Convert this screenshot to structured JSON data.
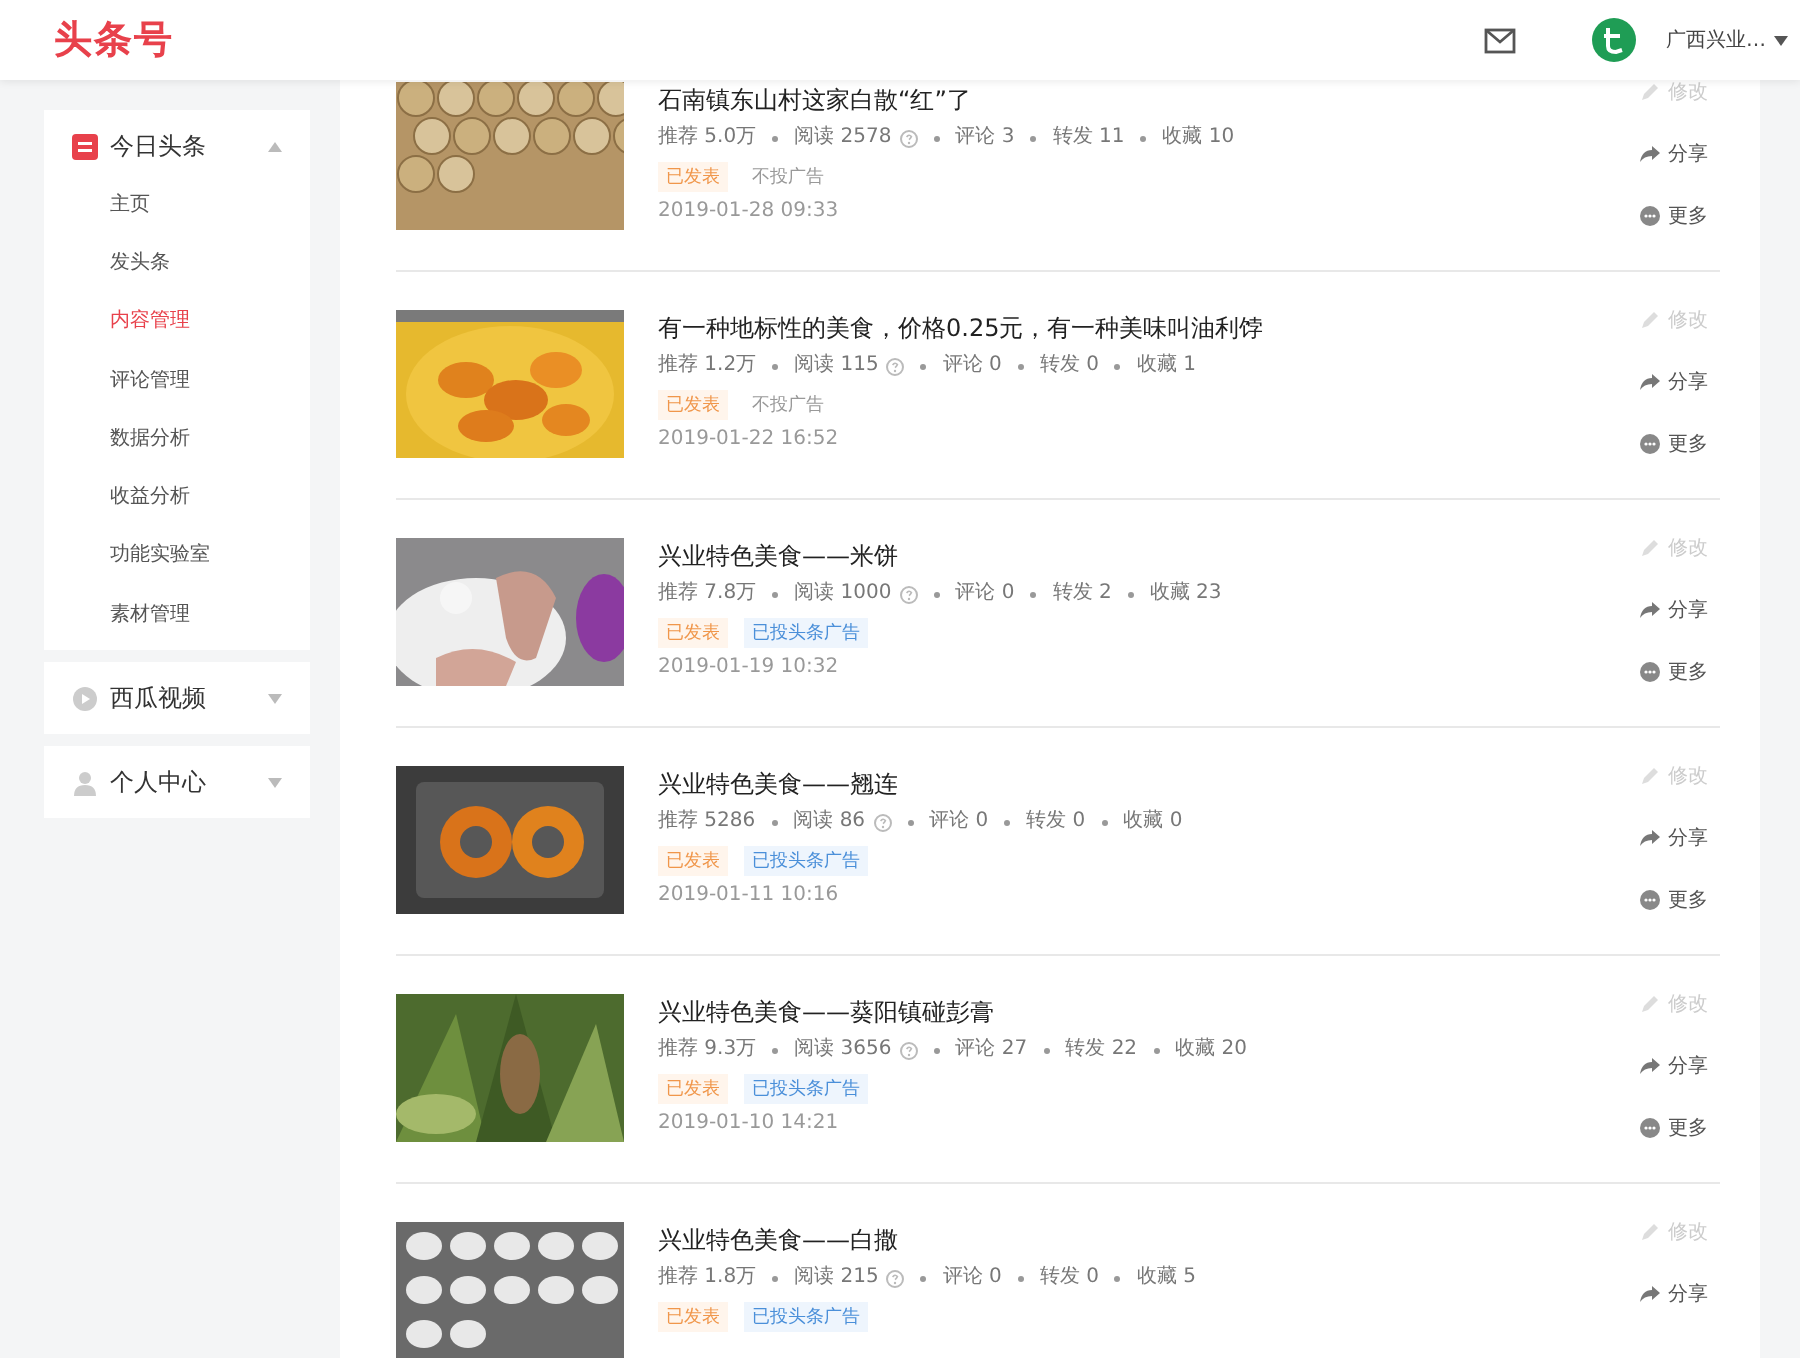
{
  "header": {
    "logo": "头条号",
    "user_name": "广西兴业…"
  },
  "sidebar": {
    "groups": [
      {
        "label": "今日头条",
        "kind": "app",
        "expanded": true,
        "children": [
          {
            "label": "主页",
            "selected": false
          },
          {
            "label": "发头条",
            "selected": false
          },
          {
            "label": "内容管理",
            "selected": true
          },
          {
            "label": "评论管理",
            "selected": false
          },
          {
            "label": "数据分析",
            "selected": false
          },
          {
            "label": "收益分析",
            "selected": false
          },
          {
            "label": "功能实验室",
            "selected": false
          },
          {
            "label": "素材管理",
            "selected": false
          }
        ]
      },
      {
        "label": "西瓜视频",
        "kind": "video",
        "expanded": false
      },
      {
        "label": "个人中心",
        "kind": "person",
        "expanded": false
      }
    ]
  },
  "articles": [
    {
      "title": "石南镇东山村这家白散“红”了",
      "stats": [
        {
          "text": "推荐 5.0万",
          "hint": false
        },
        {
          "text": "阅读 2578",
          "hint": true
        },
        {
          "text": "评论 3",
          "hint": false
        },
        {
          "text": "转发 11",
          "hint": false
        },
        {
          "text": "收藏 10",
          "hint": false
        }
      ],
      "tags": [
        {
          "text": "已发表",
          "kind": "published"
        },
        {
          "text": "不投广告",
          "kind": "no-ad"
        }
      ],
      "date": "2019-01-28 09:33",
      "actions": [
        {
          "label": "修改",
          "kind": "edit",
          "disabled": true
        },
        {
          "label": "分享",
          "kind": "share",
          "disabled": false
        },
        {
          "label": "更多",
          "kind": "more",
          "disabled": false
        }
      ]
    },
    {
      "title": "有一种地标性的美食，价格0.25元，有一种美味叫油利饽",
      "stats": [
        {
          "text": "推荐 1.2万",
          "hint": false
        },
        {
          "text": "阅读 115",
          "hint": true
        },
        {
          "text": "评论 0",
          "hint": false
        },
        {
          "text": "转发 0",
          "hint": false
        },
        {
          "text": "收藏 1",
          "hint": false
        }
      ],
      "tags": [
        {
          "text": "已发表",
          "kind": "published"
        },
        {
          "text": "不投广告",
          "kind": "no-ad"
        }
      ],
      "date": "2019-01-22 16:52",
      "actions": [
        {
          "label": "修改",
          "kind": "edit",
          "disabled": true
        },
        {
          "label": "分享",
          "kind": "share",
          "disabled": false
        },
        {
          "label": "更多",
          "kind": "more",
          "disabled": false
        }
      ]
    },
    {
      "title": "兴业特色美食——米饼",
      "stats": [
        {
          "text": "推荐 7.8万",
          "hint": false
        },
        {
          "text": "阅读 1000",
          "hint": true
        },
        {
          "text": "评论 0",
          "hint": false
        },
        {
          "text": "转发 2",
          "hint": false
        },
        {
          "text": "收藏 23",
          "hint": false
        }
      ],
      "tags": [
        {
          "text": "已发表",
          "kind": "published"
        },
        {
          "text": "已投头条广告",
          "kind": "ad"
        }
      ],
      "date": "2019-01-19 10:32",
      "actions": [
        {
          "label": "修改",
          "kind": "edit",
          "disabled": true
        },
        {
          "label": "分享",
          "kind": "share",
          "disabled": false
        },
        {
          "label": "更多",
          "kind": "more",
          "disabled": false
        }
      ]
    },
    {
      "title": "兴业特色美食——翘连",
      "stats": [
        {
          "text": "推荐 5286",
          "hint": false
        },
        {
          "text": "阅读 86",
          "hint": true
        },
        {
          "text": "评论 0",
          "hint": false
        },
        {
          "text": "转发 0",
          "hint": false
        },
        {
          "text": "收藏 0",
          "hint": false
        }
      ],
      "tags": [
        {
          "text": "已发表",
          "kind": "published"
        },
        {
          "text": "已投头条广告",
          "kind": "ad"
        }
      ],
      "date": "2019-01-11 10:16",
      "actions": [
        {
          "label": "修改",
          "kind": "edit",
          "disabled": true
        },
        {
          "label": "分享",
          "kind": "share",
          "disabled": false
        },
        {
          "label": "更多",
          "kind": "more",
          "disabled": false
        }
      ]
    },
    {
      "title": "兴业特色美食——葵阳镇碰彭膏",
      "stats": [
        {
          "text": "推荐 9.3万",
          "hint": false
        },
        {
          "text": "阅读 3656",
          "hint": true
        },
        {
          "text": "评论 27",
          "hint": false
        },
        {
          "text": "转发 22",
          "hint": false
        },
        {
          "text": "收藏 20",
          "hint": false
        }
      ],
      "tags": [
        {
          "text": "已发表",
          "kind": "published"
        },
        {
          "text": "已投头条广告",
          "kind": "ad"
        }
      ],
      "date": "2019-01-10 14:21",
      "actions": [
        {
          "label": "修改",
          "kind": "edit",
          "disabled": true
        },
        {
          "label": "分享",
          "kind": "share",
          "disabled": false
        },
        {
          "label": "更多",
          "kind": "more",
          "disabled": false
        }
      ]
    },
    {
      "title": "兴业特色美食——白撒",
      "stats": [
        {
          "text": "推荐 1.8万",
          "hint": false
        },
        {
          "text": "阅读 215",
          "hint": true
        },
        {
          "text": "评论 0",
          "hint": false
        },
        {
          "text": "转发 0",
          "hint": false
        },
        {
          "text": "收藏 5",
          "hint": false
        }
      ],
      "tags": [
        {
          "text": "已发表",
          "kind": "published"
        },
        {
          "text": "已投头条广告",
          "kind": "ad"
        }
      ],
      "actions": [
        {
          "label": "修改",
          "kind": "edit",
          "disabled": true
        },
        {
          "label": "分享",
          "kind": "share",
          "disabled": false
        }
      ]
    }
  ]
}
